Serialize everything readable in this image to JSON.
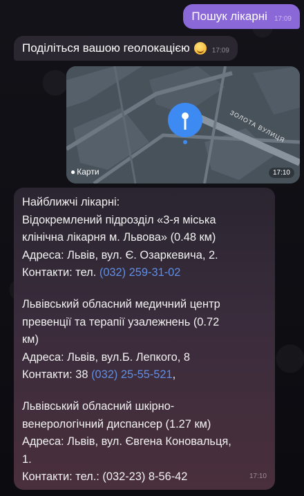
{
  "chat": {
    "outgoing": {
      "text": "Пошук лікарні",
      "time": "17:09"
    },
    "location_request": {
      "text": "Поділіться вашою геолокацією",
      "emoji": "smiling-face",
      "time": "17:09"
    },
    "map": {
      "brand": "Карти",
      "street": "ЗОЛОТА ВУЛИЦЯ",
      "time": "17:10"
    },
    "result": {
      "heading": "Найближчі лікарні:",
      "h1_name_1": "Відокремлений підрозділ «3-я міська",
      "h1_name_2": "клінічна лікарня м. Львова» (0.48 км)",
      "h1_address": "Адреса: Львів, вул. Є. Озаркевича, 2.",
      "h1_contacts_label": "Контакти: тел. ",
      "h1_phone": "(032) 259-31-02",
      "h2_name_1": "Львівський обласний медичний центр",
      "h2_name_2": "превенції та терапії узалежнень (0.72",
      "h2_name_3": "км)",
      "h2_address": "Адреса: Львів, вул.Б. Лепкого, 8",
      "h2_contacts_label": "Контакти: 38 ",
      "h2_phone": "(032) 25-55-521",
      "h2_comma": ",",
      "h3_name_1": "Львівський обласний шкірно-",
      "h3_name_2": "венерологічний диспансер (1.27 км)",
      "h3_address_1": "Адреса: Львів, вул. Євгена Коновальця,",
      "h3_address_2": "1.",
      "h3_contacts": "Контакти: тел.: (032-23) 8-56-42",
      "time": "17:10"
    }
  },
  "colors": {
    "outgoing_bubble": "#8b68d8",
    "incoming_bubble": "#2b2730",
    "link": "#5f8fe6",
    "pin": "#3d8bf2"
  }
}
